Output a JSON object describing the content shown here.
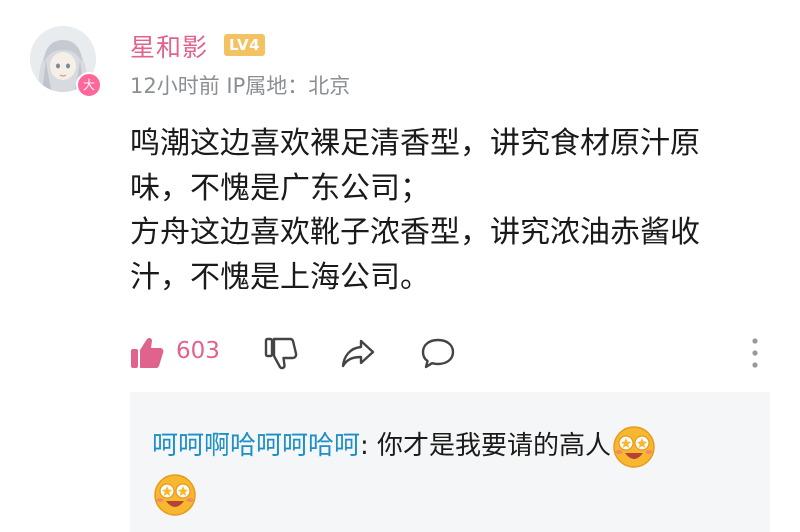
{
  "comment": {
    "username": "星和影",
    "level": "LV4",
    "avatar_badge": "大",
    "meta": "12小时前 IP属地：北京",
    "content_lines": [
      "鸣潮这边喜欢裸足清香型，讲究食材原汁原",
      "味，不愧是广东公司；",
      "方舟这边喜欢靴子浓香型，讲究浓油赤酱收",
      "汁，不愧是上海公司。"
    ],
    "like_count": "603",
    "accent_color": "#e0638d",
    "reply_user_color": "#1f8fc5"
  },
  "reply": {
    "username": "呵呵啊哈呵呵哈呵",
    "separator": ": ",
    "text": "你才是我要请的高人",
    "emojis": [
      "star-eyes-emoji",
      "star-eyes-emoji"
    ]
  },
  "icons": [
    "like-icon",
    "dislike-icon",
    "share-icon",
    "comment-icon",
    "more-icon"
  ]
}
